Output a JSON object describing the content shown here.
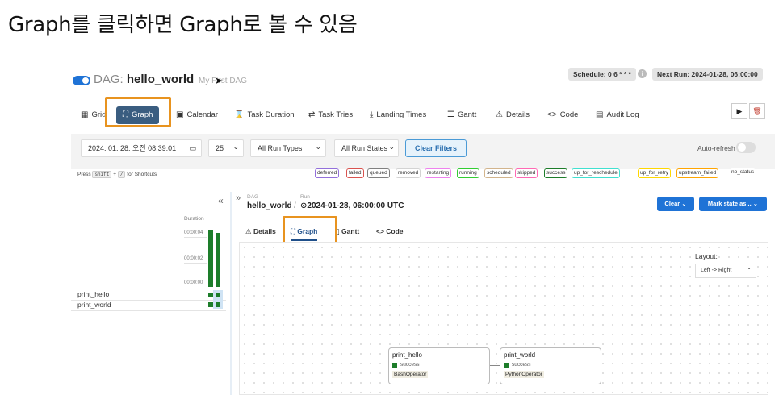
{
  "caption": "Graph를 클릭하면 Graph로 볼 수 있음",
  "header": {
    "dag_label": "DAG:",
    "dag_name": "hello_world",
    "description": "My First DAG",
    "schedule": "Schedule: 0 6 * * *",
    "next_run": "Next Run: 2024-01-28, 06:00:00",
    "info": "i"
  },
  "tabs": [
    {
      "label": "Grid",
      "icon": "grid-icon",
      "glyph": "▦"
    },
    {
      "label": "Graph",
      "icon": "graph-icon",
      "glyph": "⛶"
    },
    {
      "label": "Calendar",
      "icon": "calendar-icon",
      "glyph": "▣"
    },
    {
      "label": "Task Duration",
      "icon": "hourglass-icon",
      "glyph": "⌛"
    },
    {
      "label": "Task Tries",
      "icon": "retry-icon",
      "glyph": "⇄"
    },
    {
      "label": "Landing Times",
      "icon": "landing-icon",
      "glyph": "⤓"
    },
    {
      "label": "Gantt",
      "icon": "gantt-icon",
      "glyph": "☰"
    },
    {
      "label": "Details",
      "icon": "warning-icon",
      "glyph": "⚠"
    },
    {
      "label": "Code",
      "icon": "code-icon",
      "glyph": "<>"
    },
    {
      "label": "Audit Log",
      "icon": "file-icon",
      "glyph": "▤"
    }
  ],
  "actions": {
    "trigger": "▶",
    "delete": "🗑"
  },
  "filters": {
    "date": "2024. 01. 28. 오전 08:39:01",
    "date_icon": "▭",
    "num_runs": "25",
    "run_types": "All Run Types",
    "run_states": "All Run States",
    "clear_filters": "Clear Filters",
    "auto_refresh": "Auto-refresh",
    "chevron": "⌄"
  },
  "shortcuts": {
    "press": "Press",
    "key1": "shift",
    "plus": "+",
    "key2": "/",
    "text": "for Shortcuts"
  },
  "states": [
    {
      "label": "deferred",
      "color": "#9370db"
    },
    {
      "label": "failed",
      "color": "#d9534f"
    },
    {
      "label": "queued",
      "color": "#808080"
    },
    {
      "label": "removed",
      "color": "#d3d3d3"
    },
    {
      "label": "restarting",
      "color": "#ee82ee"
    },
    {
      "label": "running",
      "color": "#32cd32"
    },
    {
      "label": "scheduled",
      "color": "#d2b48c"
    },
    {
      "label": "skipped",
      "color": "#ff69b4"
    },
    {
      "label": "success",
      "color": "#1d7d2a"
    },
    {
      "label": "up_for_reschedule",
      "color": "#40e0d0"
    },
    {
      "label": "up_for_retry",
      "color": "#ffd700"
    },
    {
      "label": "upstream_failed",
      "color": "#ffa500"
    },
    {
      "label": "no_status",
      "color": "#ffffff"
    }
  ],
  "grid": {
    "collapse": "«",
    "duration_label": "Duration",
    "ticks": [
      "00:00:04",
      "00:00:02",
      "00:00:00"
    ],
    "tasks": [
      "print_hello",
      "print_world"
    ],
    "run_durations": [
      0.95,
      0.9
    ]
  },
  "detail": {
    "expand": "»",
    "dag_small": "DAG",
    "run_small": "Run",
    "dag_name": "hello_world",
    "sep": "/",
    "run_id": "⊙2024-01-28, 06:00:00 UTC",
    "clear": "Clear ⌄",
    "mark_state": "Mark state as... ⌄",
    "subtabs": [
      "⚠ Details",
      "⛶ Graph",
      "▯ Gantt",
      "<> Code"
    ],
    "layout_label": "Layout:",
    "layout_value": "Left -> Right",
    "nodes": [
      {
        "name": "print_hello",
        "state": "success",
        "operator": "BashOperator"
      },
      {
        "name": "print_world",
        "state": "success",
        "operator": "PythonOperator"
      }
    ]
  },
  "colors": {
    "accent": "#1f73d6",
    "active_tab": "#3a5d80",
    "highlight": "#e8931f",
    "success": "#1d7d2a"
  }
}
